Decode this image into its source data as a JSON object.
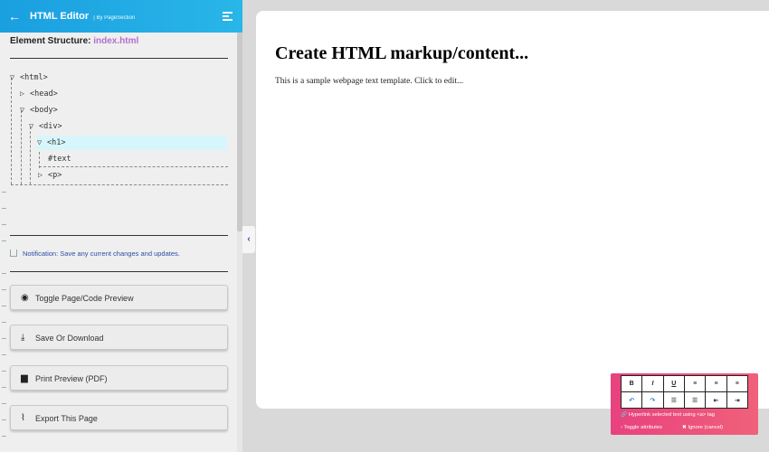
{
  "header": {
    "title": "HTML Editor",
    "byline": "| By PageSection",
    "back_glyph": "←"
  },
  "structure": {
    "label": "Element Structure:",
    "file": "index.html"
  },
  "tree": {
    "nodes": [
      {
        "arrow": "▽",
        "tag": "<html>"
      },
      {
        "arrow": "▷",
        "tag": "<head>"
      },
      {
        "arrow": "▽",
        "tag": "<body>"
      },
      {
        "arrow": "▽",
        "tag": "<div>"
      },
      {
        "arrow": "▽",
        "tag": "<h1>"
      },
      {
        "arrow": "",
        "tag": "#text"
      },
      {
        "arrow": "▷",
        "tag": "<p>"
      }
    ]
  },
  "notification": {
    "text": "Notification: Save any current changes and updates."
  },
  "buttons": [
    {
      "label": "Toggle Page/Code Preview",
      "icon": "eye-icon",
      "glyph": "◉"
    },
    {
      "label": "Save Or Download",
      "icon": "download-icon",
      "glyph": "⤓"
    },
    {
      "label": "Print Preview (PDF)",
      "icon": "printer-icon",
      "glyph": "▆"
    },
    {
      "label": "Export This Page",
      "icon": "paperclip-icon",
      "glyph": "⌇"
    }
  ],
  "collapse_glyph": "‹",
  "page": {
    "heading": "Create HTML markup/content...",
    "paragraph": "This is a sample webpage text template. Click to edit..."
  },
  "toolbar": {
    "row1": [
      {
        "glyph": "B",
        "icon": "bold-icon"
      },
      {
        "glyph": "I",
        "icon": "italic-icon"
      },
      {
        "glyph": "U",
        "icon": "underline-icon"
      },
      {
        "glyph": "≡",
        "icon": "align-left-icon"
      },
      {
        "glyph": "≡",
        "icon": "align-center-icon"
      },
      {
        "glyph": "≡",
        "icon": "align-right-icon"
      }
    ],
    "row2": [
      {
        "glyph": "↶",
        "icon": "undo-icon"
      },
      {
        "glyph": "↷",
        "icon": "redo-icon"
      },
      {
        "glyph": "☰",
        "icon": "ordered-list-icon"
      },
      {
        "glyph": "☰",
        "icon": "unordered-list-icon"
      },
      {
        "glyph": "⇤",
        "icon": "outdent-icon"
      },
      {
        "glyph": "⇥",
        "icon": "indent-icon"
      }
    ],
    "hyperlink_text": "🔗 Hyperlink selected text using <a> tag",
    "toggle_attr_text": "› Toggle attributes",
    "ignore_text": "✖ Ignore (cancel)"
  },
  "colors": {
    "header_gradient_start": "#1a9fe0",
    "toolbar_gradient_start": "#e8417f",
    "file_name": "#b06fd0",
    "selected_node": "#d7f6fc"
  }
}
